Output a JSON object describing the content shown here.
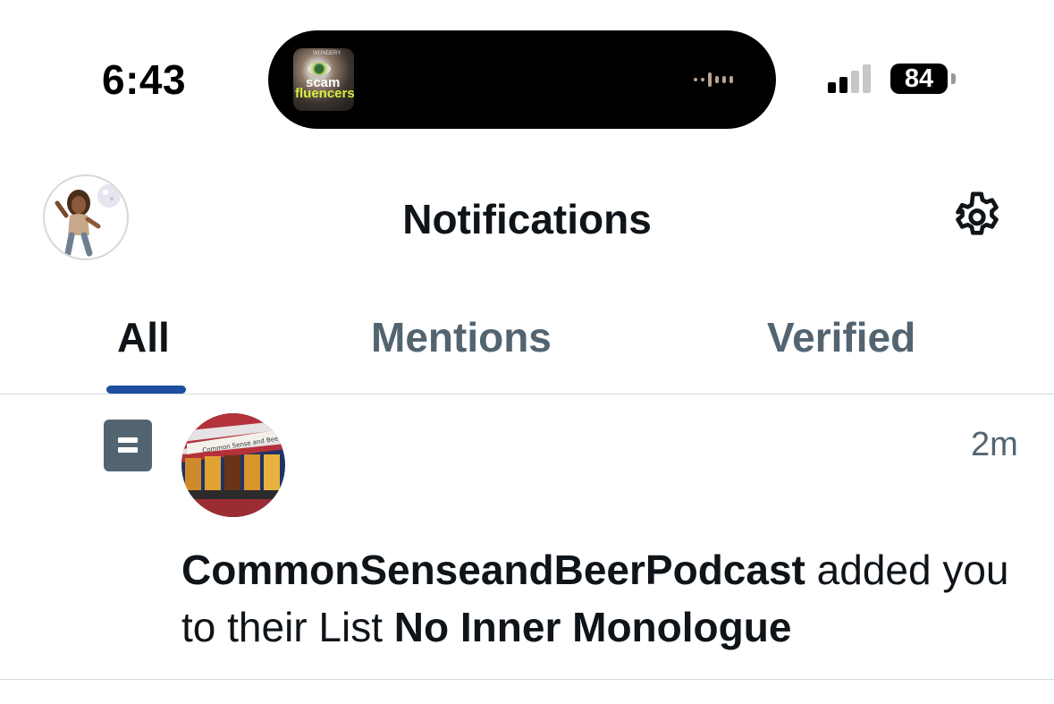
{
  "status_bar": {
    "time": "6:43",
    "now_playing_art": {
      "line1": "scam",
      "line2": "fluencers",
      "publisher": "WONDERY"
    },
    "battery_percent": "84",
    "signal_bars_active": 2,
    "signal_bars_total": 4
  },
  "header": {
    "title": "Notifications",
    "settings_icon": "gear-icon"
  },
  "tabs": [
    {
      "label": "All",
      "selected": true
    },
    {
      "label": "Mentions",
      "selected": false
    },
    {
      "label": "Verified",
      "selected": false
    }
  ],
  "notifications": [
    {
      "type_icon": "list-icon",
      "timestamp": "2m",
      "actor": "CommonSenseandBeerPodcast",
      "action": " added you to their List ",
      "list_name": "No Inner Monologue",
      "avatar_banner_text": "Common Sense and Beer"
    }
  ],
  "colors": {
    "primary_text": "#0f1419",
    "secondary_text": "#536471",
    "tab_indicator": "#1d4ea0",
    "divider": "#cfd9de"
  }
}
